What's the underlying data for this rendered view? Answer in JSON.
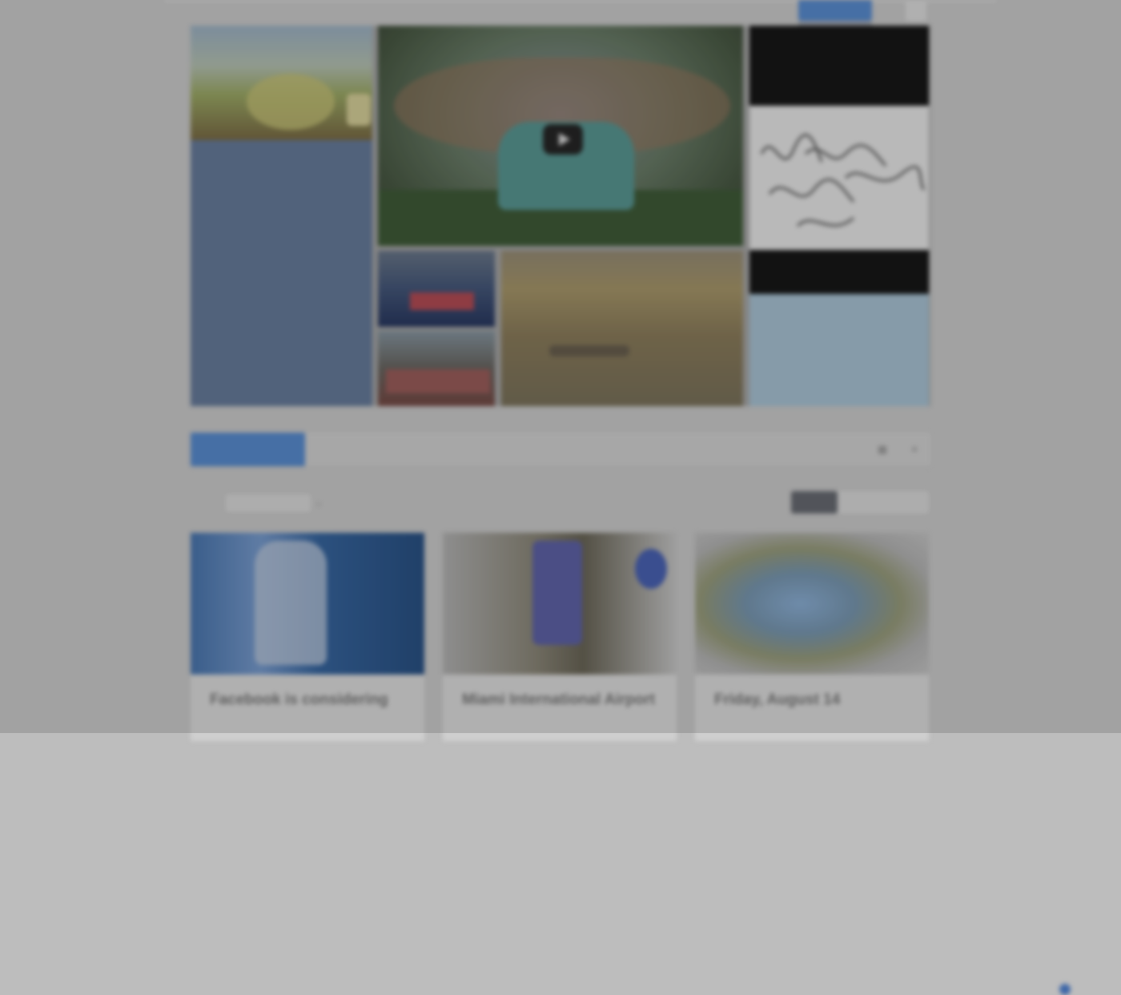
{
  "header": {
    "active_tab_label": "",
    "dropdown_lines": [
      "",
      ""
    ]
  },
  "featured": {
    "left_card": {
      "title": "",
      "body": ""
    },
    "right_card": {
      "title": "",
      "body": ""
    },
    "video_overlay": "play-icon"
  },
  "tabs": {
    "items": [
      {
        "label": ""
      },
      {
        "label": ""
      },
      {
        "label": ""
      },
      {
        "label": ""
      },
      {
        "label": ""
      }
    ],
    "active_index": 0,
    "icons": [
      "grid-icon",
      "list-icon"
    ]
  },
  "filters": {
    "sort_label": "",
    "sort_value": "",
    "legend": [
      "",
      "",
      ""
    ],
    "view_options": [
      "",
      "",
      ""
    ]
  },
  "cards": [
    {
      "title": "Facebook is considering",
      "desc": "",
      "cap_left": "",
      "cap_right": ""
    },
    {
      "title": "Miami International Airport",
      "desc": "",
      "cap_left": "",
      "cap_right": ""
    },
    {
      "title": "Friday, August 14",
      "desc": "",
      "cap_left": "",
      "cap_right": ""
    }
  ],
  "side_more": {
    "line1": "",
    "line2": ""
  },
  "colors": {
    "accent": "#4d7fc1",
    "left_card_bg": "#5b6f8e",
    "right_card_bg": "#9bb5c6",
    "overlay": "#bdbdbd"
  }
}
